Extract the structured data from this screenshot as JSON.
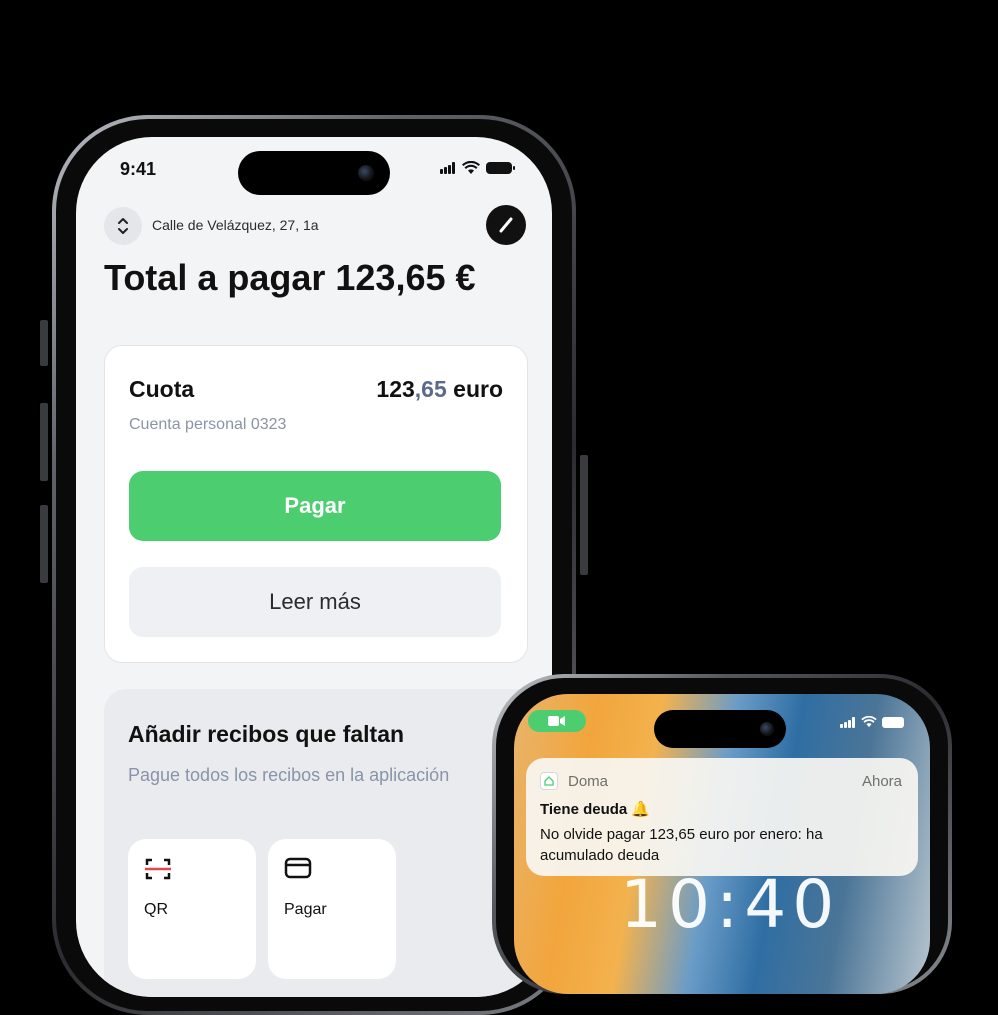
{
  "phone1": {
    "status": {
      "time": "9:41"
    },
    "header": {
      "address": "Calle de Velázquez, 27, 1a"
    },
    "title": "Total a pagar 123,65 €",
    "card": {
      "label": "Cuota",
      "amount_whole": "123",
      "amount_cents": ",65",
      "amount_unit": " euro",
      "account": "Cuenta personal 0323",
      "pay_button": "Pagar",
      "read_more_button": "Leer más"
    },
    "missing": {
      "title": "Añadir recibos que faltan",
      "subtitle": "Pague todos los recibos en la aplicación",
      "tiles": [
        {
          "label": "QR",
          "icon": "qr-scan-icon"
        },
        {
          "label": "Pagar",
          "icon": "card-icon"
        }
      ]
    }
  },
  "phone2": {
    "notification": {
      "app": "Doma",
      "time": "Ahora",
      "title": "Tiene deuda 🔔",
      "body": "No olvide pagar 123,65 euro por enero: ha acumulado deuda"
    },
    "clock": "10:40"
  },
  "colors": {
    "accent_green": "#4cce70",
    "muted_text": "#8a93a8",
    "cents_blue": "#5b6a8a"
  }
}
